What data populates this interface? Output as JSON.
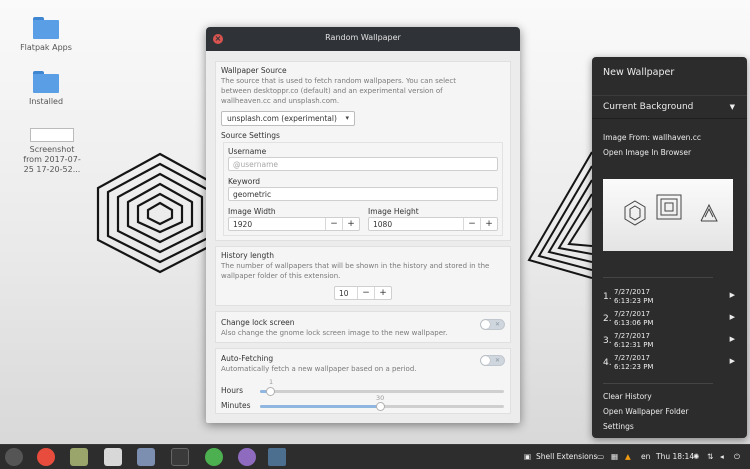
{
  "desktop": {
    "icons": [
      {
        "label_lines": [
          "Flatpak Apps"
        ],
        "type": "folder"
      },
      {
        "label_lines": [
          "Installed"
        ],
        "type": "folder"
      },
      {
        "label_lines": [
          "Screenshot",
          "from 2017-07-",
          "25 17-20-52..."
        ],
        "type": "image"
      }
    ]
  },
  "dialog": {
    "title": "Random Wallpaper",
    "close_icon": "close-icon",
    "source": {
      "heading": "Wallpaper Source",
      "description": "The source that is used to fetch random wallpapers. You can select between desktoppr.co (default) and an experimental version of wallheaven.cc and unsplash.com.",
      "selected": "unsplash.com (experimental)"
    },
    "source_settings": {
      "heading": "Source Settings",
      "username_label": "Username",
      "username_value": "",
      "username_placeholder": "@username",
      "keyword_label": "Keyword",
      "keyword_value": "geometric",
      "width_label": "Image Width",
      "width_value": "1920",
      "height_label": "Image Height",
      "height_value": "1080"
    },
    "history": {
      "heading": "History length",
      "description": "The number of wallpapers that will be shown in the history and stored in the wallpaper folder of this extension.",
      "value": "10"
    },
    "lock_screen": {
      "heading": "Change lock screen",
      "description": "Also change the gnome lock screen image to the new wallpaper.",
      "enabled": false
    },
    "auto_fetch": {
      "heading": "Auto-Fetching",
      "description": "Automatically fetch a new wallpaper based on a period.",
      "enabled": false,
      "hours_label": "Hours",
      "hours_value": "1",
      "hours_fraction": 0.04,
      "minutes_label": "Minutes",
      "minutes_value": "30",
      "minutes_fraction": 0.49
    },
    "minus": "−",
    "plus": "+"
  },
  "panel": {
    "title": "New Wallpaper",
    "current_background": "Current Background",
    "image_from": "Image From: wallhaven.cc",
    "open_browser": "Open Image In Browser",
    "history": [
      {
        "index": "1.",
        "date": "7/27/2017",
        "time": "6:13:23 PM"
      },
      {
        "index": "2.",
        "date": "7/27/2017",
        "time": "6:13:06 PM"
      },
      {
        "index": "3.",
        "date": "7/27/2017",
        "time": "6:12:31 PM"
      },
      {
        "index": "4.",
        "date": "7/27/2017",
        "time": "6:12:23 PM"
      }
    ],
    "clear_history": "Clear History",
    "open_folder": "Open Wallpaper Folder",
    "settings": "Settings"
  },
  "taskbar": {
    "shell_extensions": "Shell Extensions",
    "language": "en",
    "clock": "Thu 18:14",
    "accent": "#e74c3c"
  }
}
